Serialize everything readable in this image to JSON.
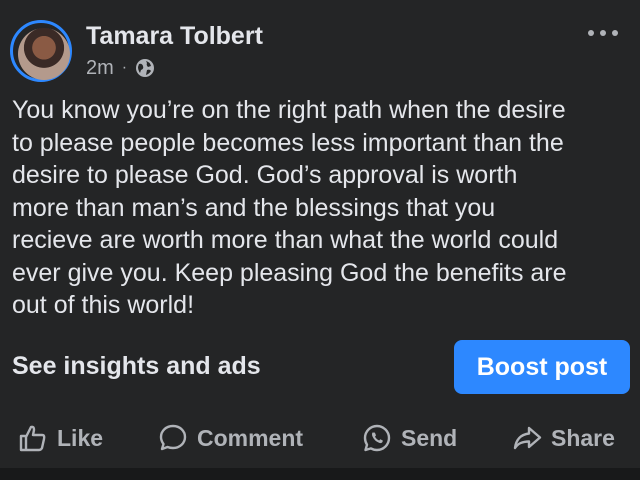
{
  "post": {
    "author": "Tamara Tolbert",
    "time": "2m",
    "separator": "·",
    "visibility_icon": "globe-icon",
    "more_icon": "more-options-icon",
    "text": "You know you’re on the right path when the desire\nto please people becomes less important than the\ndesire to please God. God’s approval is worth\nmore than man’s and the blessings that you\nrecieve are worth more than what the world could\never give you. Keep pleasing God the benefits are\nout of this world!"
  },
  "insights": {
    "label": "See insights and ads"
  },
  "boost": {
    "label": "Boost post"
  },
  "actions": {
    "like": "Like",
    "comment": "Comment",
    "send": "Send",
    "share": "Share"
  },
  "colors": {
    "background": "#242526",
    "primary_text": "#e4e6eb",
    "secondary_text": "#b0b3b8",
    "accent": "#2d88ff"
  }
}
